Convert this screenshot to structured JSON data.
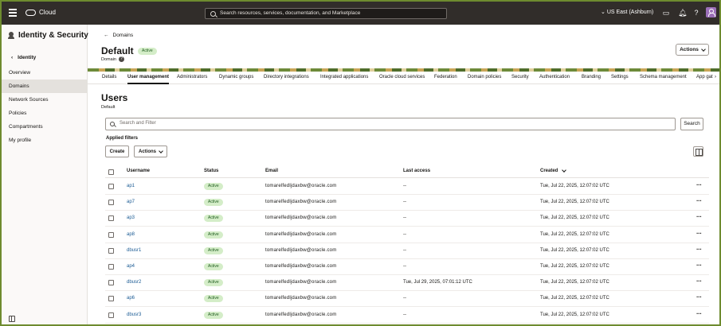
{
  "topbar": {
    "brand": "Cloud",
    "search_placeholder": "Search resources, services, documentation, and Marketplace",
    "region": "US East (Ashburn)"
  },
  "sidebar": {
    "title": "Identity & Security",
    "back_label": "Identity",
    "items": [
      {
        "label": "Overview",
        "active": false
      },
      {
        "label": "Domains",
        "active": true
      },
      {
        "label": "Network Sources",
        "active": false
      },
      {
        "label": "Policies",
        "active": false
      },
      {
        "label": "Compartments",
        "active": false
      },
      {
        "label": "My profile",
        "active": false
      }
    ]
  },
  "header": {
    "breadcrumb": "Domains",
    "title": "Default",
    "status": "Active",
    "subtitle": "Domain",
    "actions_label": "Actions"
  },
  "tabs": [
    {
      "label": "Details"
    },
    {
      "label": "User management",
      "active": true
    },
    {
      "label": "Administrators"
    },
    {
      "label": "Dynamic groups"
    },
    {
      "label": "Directory integrations"
    },
    {
      "label": "Integrated applications"
    },
    {
      "label": "Oracle cloud services"
    },
    {
      "label": "Federation"
    },
    {
      "label": "Domain policies"
    },
    {
      "label": "Security"
    },
    {
      "label": "Authentication"
    },
    {
      "label": "Branding"
    },
    {
      "label": "Settings"
    },
    {
      "label": "Schema management"
    },
    {
      "label": "App gat"
    }
  ],
  "users": {
    "title": "Users",
    "subtitle": "Default",
    "search_placeholder": "Search and Filter",
    "search_button": "Search",
    "applied_filters": "Applied filters",
    "create_button": "Create",
    "actions_button": "Actions",
    "columns": {
      "username": "Username",
      "status": "Status",
      "email": "Email",
      "last_access": "Last access",
      "created": "Created"
    },
    "rows": [
      {
        "username": "ap1",
        "status": "Active",
        "email": "tomarelfedljdaxbw@oracle.com",
        "last_access": "--",
        "created": "Tue, Jul 22, 2025, 12:07:02 UTC"
      },
      {
        "username": "ap7",
        "status": "Active",
        "email": "tomarelfedljdaxbw@oracle.com",
        "last_access": "--",
        "created": "Tue, Jul 22, 2025, 12:07:02 UTC"
      },
      {
        "username": "ap3",
        "status": "Active",
        "email": "tomarelfedljdaxbw@oracle.com",
        "last_access": "--",
        "created": "Tue, Jul 22, 2025, 12:07:02 UTC"
      },
      {
        "username": "ap8",
        "status": "Active",
        "email": "tomarelfedljdaxbw@oracle.com",
        "last_access": "--",
        "created": "Tue, Jul 22, 2025, 12:07:02 UTC"
      },
      {
        "username": "dbusr1",
        "status": "Active",
        "email": "tomarelfedljdaxbw@oracle.com",
        "last_access": "--",
        "created": "Tue, Jul 22, 2025, 12:07:02 UTC"
      },
      {
        "username": "ap4",
        "status": "Active",
        "email": "tomarelfedljdaxbw@oracle.com",
        "last_access": "--",
        "created": "Tue, Jul 22, 2025, 12:07:02 UTC"
      },
      {
        "username": "dbusr2",
        "status": "Active",
        "email": "tomarelfedljdaxbw@oracle.com",
        "last_access": "Tue, Jul 29, 2025, 07:01:12 UTC",
        "created": "Tue, Jul 22, 2025, 12:07:02 UTC"
      },
      {
        "username": "ap6",
        "status": "Active",
        "email": "tomarelfedljdaxbw@oracle.com",
        "last_access": "--",
        "created": "Tue, Jul 22, 2025, 12:07:02 UTC"
      },
      {
        "username": "dbusr3",
        "status": "Active",
        "email": "tomarelfedljdaxbw@oracle.com",
        "last_access": "--",
        "created": "Tue, Jul 22, 2025, 12:07:02 UTC"
      }
    ]
  }
}
